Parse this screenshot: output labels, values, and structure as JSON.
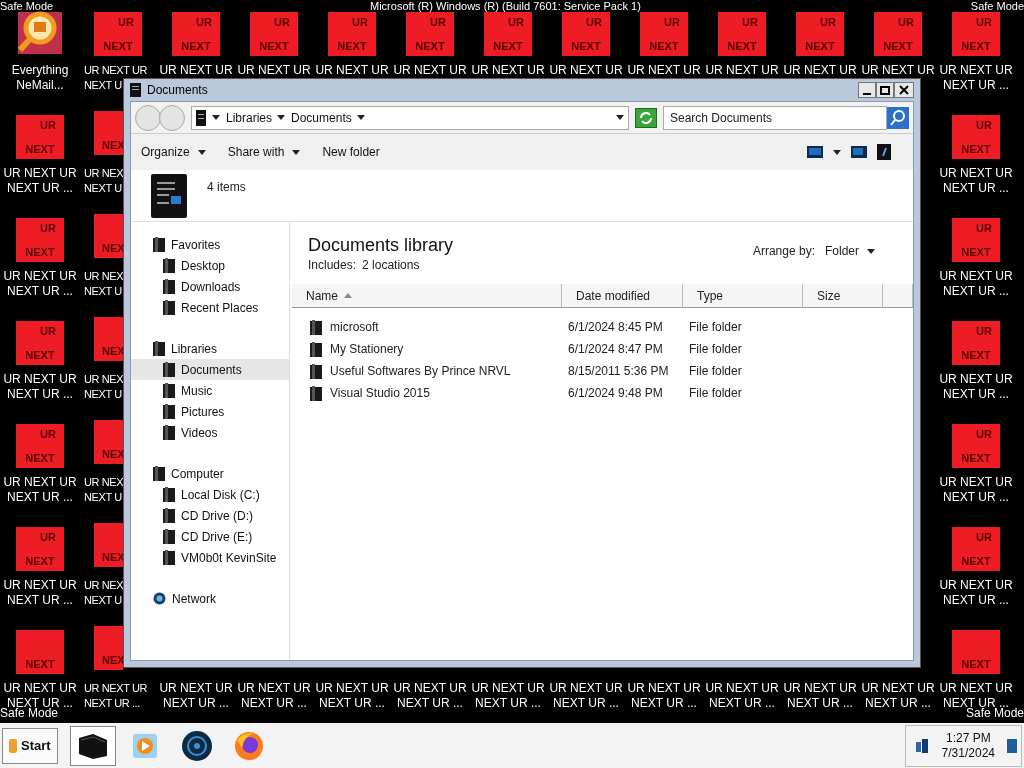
{
  "desktop": {
    "top_left": "Safe Mode",
    "top_center": "Microsoft (R) Windows (R) (Build 7601: Service Pack 1)",
    "top_right": "Safe Mode",
    "bottom_left": "Safe Mode",
    "bottom_right": "Safe Mode",
    "icon_rows": [
      {
        "left": [
          {
            "kind": "app",
            "label": [
              "Everything",
              "NeMail..."
            ]
          },
          {
            "kind": "tile",
            "tile": [
              "UR",
              "NEXT"
            ],
            "label": [
              "UR NEXT UR",
              "NEXT U"
            ]
          },
          {
            "kind": "tile",
            "tile": [
              "UR",
              "NEXT"
            ],
            "label": [
              "UR NEXT UR"
            ]
          },
          {
            "kind": "tile",
            "tile": [
              "UR",
              "NEXT"
            ],
            "label": [
              "UR NEXT UR"
            ]
          },
          {
            "kind": "tile",
            "tile": [
              "UR",
              "NEXT"
            ],
            "label": [
              "UR NEXT UR"
            ]
          },
          {
            "kind": "tile",
            "tile": [
              "UR",
              "NEXT"
            ],
            "label": [
              "UR NEXT UR"
            ]
          },
          {
            "kind": "tile",
            "tile": [
              "UR",
              "NEXT"
            ],
            "label": [
              "UR NEXT UR"
            ]
          },
          {
            "kind": "tile",
            "tile": [
              "UR",
              "NEXT"
            ],
            "label": [
              "UR NEXT UR"
            ]
          },
          {
            "kind": "tile",
            "tile": [
              "UR",
              "NEXT"
            ],
            "label": [
              "UR NEXT UR"
            ]
          },
          {
            "kind": "tile",
            "tile": [
              "UR",
              "NEXT"
            ],
            "label": [
              "UR NEXT UR"
            ]
          },
          {
            "kind": "tile",
            "tile": [
              "UR",
              "NEXT"
            ],
            "label": [
              "UR NEXT UR"
            ]
          },
          {
            "kind": "tile",
            "tile": [
              "UR",
              "NEXT"
            ],
            "label": [
              "UR NEXT UR"
            ]
          },
          {
            "kind": "tile",
            "tile": [
              "UR",
              "NEXT"
            ],
            "label": [
              "UR NEXT UR",
              "NEXT UR ..."
            ]
          }
        ],
        "right": []
      },
      {
        "left": [
          {
            "kind": "tile",
            "tile": [
              "UR",
              "NEXT"
            ],
            "label": [
              "UR NEXT UR",
              "NEXT UR ..."
            ]
          },
          {
            "kind": "partial_tile",
            "tile": [
              "NEX"
            ],
            "label": [
              "UR NEX",
              "NEXT U"
            ]
          }
        ],
        "right": [
          {
            "kind": "tile",
            "tile": [
              "UR",
              "NEXT"
            ],
            "label": [
              "UR NEXT UR",
              "NEXT UR ..."
            ]
          }
        ]
      },
      {
        "left": [
          {
            "kind": "tile",
            "tile": [
              "UR",
              "NEXT"
            ],
            "label": [
              "UR NEXT UR",
              "NEXT UR ..."
            ]
          },
          {
            "kind": "partial_tile",
            "tile": [
              "NEX"
            ],
            "label": [
              "UR NEX",
              "NEXT U"
            ]
          }
        ],
        "right": [
          {
            "kind": "tile",
            "tile": [
              "UR",
              "NEXT"
            ],
            "label": [
              "UR NEXT UR",
              "NEXT UR ..."
            ]
          }
        ]
      },
      {
        "left": [
          {
            "kind": "tile",
            "tile": [
              "UR",
              "NEXT"
            ],
            "label": [
              "UR NEXT UR",
              "NEXT UR ..."
            ]
          },
          {
            "kind": "partial_tile",
            "tile": [
              "NEX"
            ],
            "label": [
              "UR NEX",
              "NEXT U"
            ]
          }
        ],
        "right": [
          {
            "kind": "tile",
            "tile": [
              "UR",
              "NEXT"
            ],
            "label": [
              "UR NEXT UR",
              "NEXT UR ..."
            ]
          }
        ]
      },
      {
        "left": [
          {
            "kind": "tile",
            "tile": [
              "UR",
              "NEXT"
            ],
            "label": [
              "UR NEXT UR",
              "NEXT UR ..."
            ]
          },
          {
            "kind": "partial_tile",
            "tile": [
              "NEX"
            ],
            "label": [
              "UR NEX",
              "NEXT U"
            ]
          }
        ],
        "right": [
          {
            "kind": "tile",
            "tile": [
              "UR",
              "NEXT"
            ],
            "label": [
              "UR NEXT UR",
              "NEXT UR ..."
            ]
          }
        ]
      },
      {
        "left": [
          {
            "kind": "tile",
            "tile": [
              "UR",
              "NEXT"
            ],
            "label": [
              "UR NEXT UR",
              "NEXT UR ..."
            ]
          },
          {
            "kind": "partial_tile",
            "tile": [
              "NEX"
            ],
            "label": [
              "UR NEX",
              "NEXT U"
            ]
          }
        ],
        "right": [
          {
            "kind": "tile",
            "tile": [
              "UR",
              "NEXT"
            ],
            "label": [
              "UR NEXT UR",
              "NEXT UR ..."
            ]
          }
        ]
      },
      {
        "left": [
          {
            "kind": "tile",
            "tile": [
              "NEXT"
            ],
            "label": [
              "UR NEXT UR",
              "NEXT UR ..."
            ]
          },
          {
            "kind": "partial_tile",
            "tile": [
              "NEX"
            ],
            "label": [
              "UR NEXT UR",
              "NEXT UR ..."
            ]
          },
          {
            "kind": "label_only",
            "label": [
              "UR NEXT UR",
              "NEXT UR ..."
            ]
          },
          {
            "kind": "label_only",
            "label": [
              "UR NEXT UR",
              "NEXT UR ..."
            ]
          },
          {
            "kind": "label_only",
            "label": [
              "UR NEXT UR",
              "NEXT UR ..."
            ]
          },
          {
            "kind": "label_only",
            "label": [
              "UR NEXT UR",
              "NEXT UR ..."
            ]
          },
          {
            "kind": "label_only",
            "label": [
              "UR NEXT UR",
              "NEXT UR ..."
            ]
          },
          {
            "kind": "label_only",
            "label": [
              "UR NEXT UR",
              "NEXT UR ..."
            ]
          },
          {
            "kind": "label_only",
            "label": [
              "UR NEXT UR",
              "NEXT UR ..."
            ]
          },
          {
            "kind": "label_only",
            "label": [
              "UR NEXT UR",
              "NEXT UR ..."
            ]
          },
          {
            "kind": "label_only",
            "label": [
              "UR NEXT UR",
              "NEXT UR ..."
            ]
          },
          {
            "kind": "label_only",
            "label": [
              "UR NEXT UR",
              "NEXT UR ..."
            ]
          },
          {
            "kind": "tile",
            "tile": [
              "NEXT"
            ],
            "label": [
              "UR NEXT UR",
              "NEXT UR ..."
            ]
          }
        ],
        "right": []
      }
    ]
  },
  "window": {
    "title": "Documents",
    "address": {
      "crumbs": [
        "Libraries",
        "Documents"
      ]
    },
    "search": {
      "placeholder": "Search Documents"
    },
    "toolbar": [
      {
        "label": "Organize",
        "menu": true
      },
      {
        "label": "Share with",
        "menu": true
      },
      {
        "label": "New folder",
        "menu": false
      }
    ],
    "details": {
      "count": "4 items"
    },
    "sidebar": [
      {
        "label": "Favorites",
        "children": [
          {
            "label": "Desktop",
            "selected": false
          },
          {
            "label": "Downloads",
            "selected": false
          },
          {
            "label": "Recent Places",
            "selected": false
          }
        ]
      },
      {
        "label": "Libraries",
        "children": [
          {
            "label": "Documents",
            "selected": true
          },
          {
            "label": "Music",
            "selected": false
          },
          {
            "label": "Pictures",
            "selected": false
          },
          {
            "label": "Videos",
            "selected": false
          }
        ]
      },
      {
        "label": "Computer",
        "children": [
          {
            "label": "Local Disk (C:)",
            "selected": false
          },
          {
            "label": "CD Drive (D:)",
            "selected": false
          },
          {
            "label": "CD Drive (E:)",
            "selected": false
          },
          {
            "label": "VM0b0t KevinSite",
            "selected": false
          }
        ]
      },
      {
        "label": "Network"
      }
    ],
    "library": {
      "title": "Documents library",
      "includes_label": "Includes:",
      "includes_value": "2 locations",
      "arrange_label": "Arrange by:",
      "arrange_value": "Folder"
    },
    "table": {
      "columns": [
        {
          "label": "Name",
          "sorted": true
        },
        {
          "label": "Date modified",
          "sorted": false
        },
        {
          "label": "Type",
          "sorted": false
        },
        {
          "label": "Size",
          "sorted": false
        }
      ],
      "rows": [
        {
          "name": "microsoft",
          "date": "6/1/2024 8:45 PM",
          "type": "File folder"
        },
        {
          "name": "My Stationery",
          "date": "6/1/2024 8:47 PM",
          "type": "File folder"
        },
        {
          "name": "Useful Softwares By Prince NRVL",
          "date": "8/15/2011 5:36 PM",
          "type": "File folder"
        },
        {
          "name": "Visual Studio 2015",
          "date": "6/1/2024 9:48 PM",
          "type": "File folder"
        }
      ]
    }
  },
  "taskbar": {
    "start": "Start",
    "apps": [
      {
        "selected": true
      },
      {
        "selected": false
      },
      {
        "selected": false
      },
      {
        "selected": false
      }
    ],
    "time": "1:27 PM",
    "date": "7/31/2024"
  }
}
